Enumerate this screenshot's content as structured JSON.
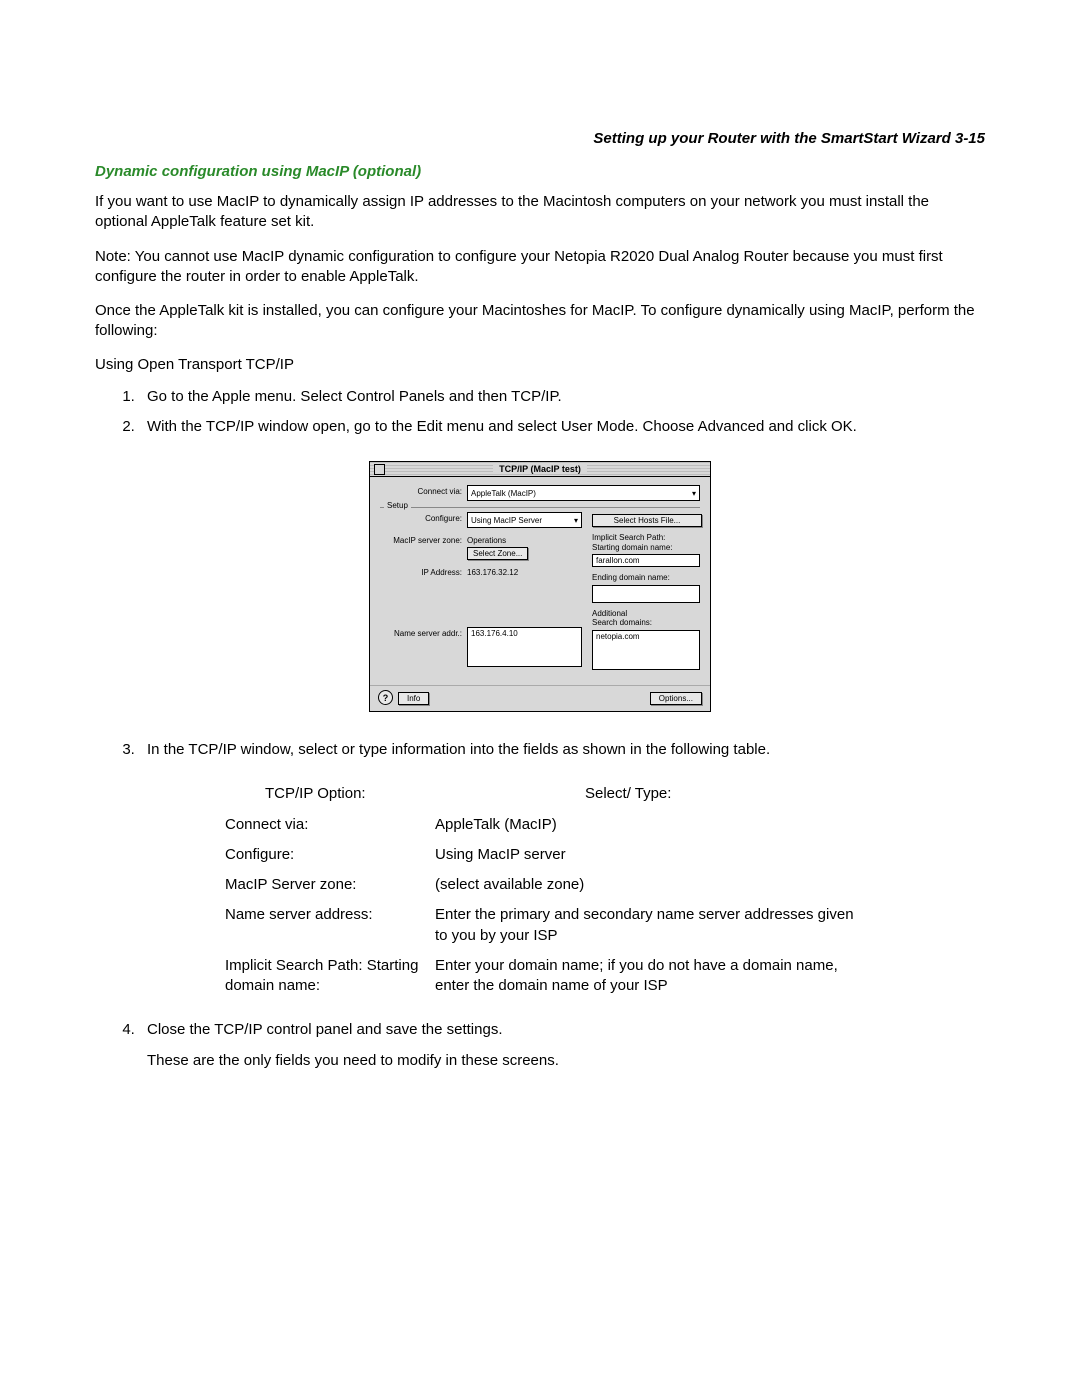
{
  "header": "Setting up your Router with the SmartStart Wizard   3-15",
  "subheading": "Dynamic configuration using MacIP (optional)",
  "paragraphs": {
    "p1": "If you want to use MacIP to dynamically assign IP addresses to the Macintosh computers on your network you must install the optional AppleTalk feature set kit.",
    "p2": "Note:  You cannot use MacIP dynamic configuration to configure your Netopia R2020 Dual Analog Router because you must first configure the router in order to enable AppleTalk.",
    "p3": "Once the AppleTalk kit is installed, you can configure your Macintoshes for MacIP. To configure dynamically using MacIP, perform the following:"
  },
  "section_label": "Using Open Transport TCP/IP",
  "steps": {
    "s1": "Go to the Apple menu. Select Control Panels and then TCP/IP.",
    "s2": "With the TCP/IP window open, go to the Edit menu and select User Mode. Choose Advanced and click OK.",
    "s3": "In the TCP/IP window, select or type information into the fields as shown in the following table.",
    "s4": "Close the TCP/IP control panel and save the settings.",
    "s4b": "These are the only fields you need to modify in these screens."
  },
  "dialog": {
    "title": "TCP/IP (MacIP test)",
    "setup_label": "Setup",
    "connect_via_label": "Connect via:",
    "connect_via_value": "AppleTalk (MacIP)",
    "configure_label": "Configure:",
    "configure_value": "Using MacIP Server",
    "zone_label": "MacIP server zone:",
    "zone_value": "Operations",
    "select_zone_btn": "Select Zone...",
    "ip_label": "IP Address:",
    "ip_value": "163.176.32.12",
    "ns_label": "Name server addr.:",
    "ns_value": "163.176.4.10",
    "hosts_btn": "Select Hosts File...",
    "implicit_label": "Implicit Search Path:\nStarting domain name:",
    "implicit_value": "farallon.com",
    "ending_label": "Ending domain name:",
    "additional_label": "Additional\nSearch domains:",
    "additional_value": "netopia.com",
    "info_btn": "Info",
    "options_btn": "Options...",
    "help_glyph": "?"
  },
  "table": {
    "head_left": "TCP/IP Option:",
    "head_right": "Select/ Type:",
    "rows": [
      {
        "left": "Connect via:",
        "right": "AppleTalk (MacIP)"
      },
      {
        "left": "Configure:",
        "right": "Using MacIP server"
      },
      {
        "left": "MacIP Server zone:",
        "right": "(select available zone)"
      },
      {
        "left": "Name server address:",
        "right": "Enter the primary and secondary name server addresses given to you by your ISP"
      },
      {
        "left": "Implicit Search Path: Starting domain name:",
        "right": "Enter your domain name; if you do not have a domain name, enter the domain name of your ISP"
      }
    ]
  }
}
